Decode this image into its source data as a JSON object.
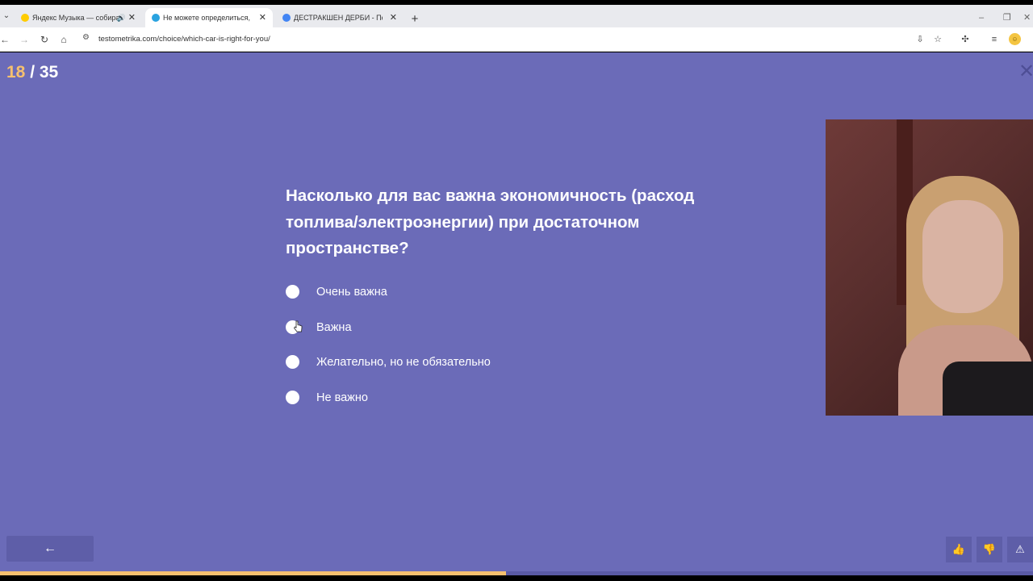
{
  "browser": {
    "tabs": [
      {
        "title": "Яндекс Музыка — собираем…",
        "favicon_color": "#ffcc00",
        "audio_icon": "🔊",
        "close": "✕",
        "active": false
      },
      {
        "title": "Не можете определиться, как…",
        "favicon_color": "#2aa3e0",
        "close": "✕",
        "active": true
      },
      {
        "title": "ДЕСТРАКШЕН ДЕРБИ - Поиск…",
        "favicon_color": "#4285f4",
        "close": "✕",
        "active": false
      }
    ],
    "tab_menu": "⌄",
    "new_tab": "+",
    "window_controls": {
      "minimize": "–",
      "restore": "❐",
      "close": "✕"
    },
    "nav": {
      "back": "←",
      "forward": "→",
      "reload": "↻",
      "home": "⌂"
    },
    "address": "testometrika.com/choice/which-car-is-right-for-you/",
    "toolbar_icons": [
      "install-icon",
      "star-icon",
      "extensions-icon",
      "media-icon",
      "profile-icon"
    ]
  },
  "quiz": {
    "current": "18",
    "separator": " / ",
    "total": "35",
    "close": "✕",
    "question": "Насколько для вас важна экономичность (расход топлива/электроэнергии) при достаточном пространстве?",
    "options": [
      "Очень важна",
      "Важна",
      "Желательно, но не обязательно",
      "Не важно"
    ],
    "back_button": "←",
    "progress_fraction": 0.49,
    "colors": {
      "background": "#6b6bb8",
      "accent": "#f5c06f",
      "button": "#5e5ea8"
    }
  },
  "feedback": {
    "like": "👍",
    "dislike": "👎",
    "report": "⚠"
  }
}
